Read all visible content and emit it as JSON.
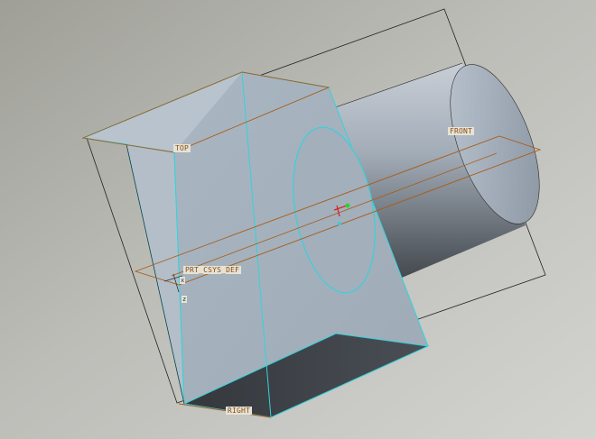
{
  "datum_planes": {
    "top": "TOP",
    "front": "FRONT",
    "right": "RIGHT"
  },
  "coordinate_system": {
    "name": "PRT_CSYS_DEF",
    "axis_x": "x",
    "axis_z": "z"
  },
  "model_colors": {
    "background_light": "#c6c6c2",
    "background_dark": "#9e9e97",
    "edge_highlight": "#33d2dc",
    "datum_plane": "#a85c18",
    "outline": "#222222"
  }
}
